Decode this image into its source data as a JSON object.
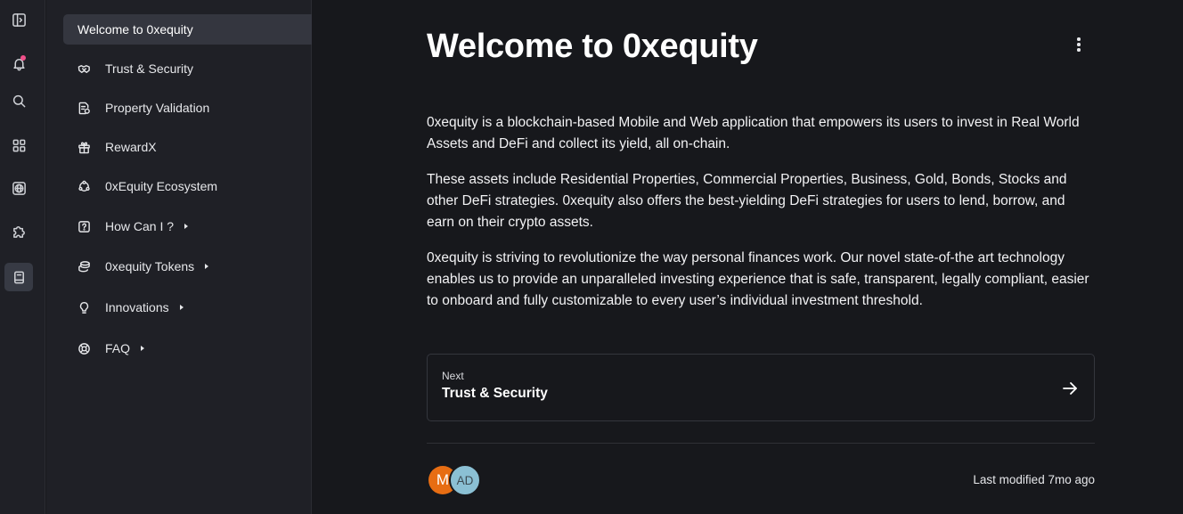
{
  "rail": {
    "icons": [
      "sidebar-toggle-icon",
      "bell-icon",
      "search-icon",
      "grid-icon",
      "globe-icon",
      "puzzle-icon",
      "book-icon"
    ]
  },
  "sidebar": {
    "items": [
      {
        "label": "Welcome to 0xequity",
        "icon": null,
        "active": true,
        "has_submenu": false
      },
      {
        "label": "Trust & Security",
        "icon": "handshake-icon",
        "has_submenu": false
      },
      {
        "label": "Property Validation",
        "icon": "document-check-icon",
        "has_submenu": false
      },
      {
        "label": "RewardX",
        "icon": "gift-icon",
        "has_submenu": false
      },
      {
        "label": "0xEquity Ecosystem",
        "icon": "circle-nodes-icon",
        "has_submenu": false
      },
      {
        "label": "How Can I ?",
        "icon": "question-square-icon",
        "has_submenu": true
      },
      {
        "label": "0xequity Tokens",
        "icon": "coins-icon",
        "has_submenu": true
      },
      {
        "label": "Innovations",
        "icon": "lightbulb-icon",
        "has_submenu": true
      },
      {
        "label": "FAQ",
        "icon": "help-circle-icon",
        "has_submenu": true
      }
    ]
  },
  "main": {
    "title": "Welcome to 0xequity",
    "paragraphs": [
      "0xequity is a blockchain-based Mobile and Web application that empowers its users to invest in Real World Assets and DeFi and collect its yield, all on-chain.",
      "These assets include Residential Properties, Commercial Properties, Business, Gold, Bonds, Stocks and other DeFi strategies. 0xequity also offers the best-yielding DeFi strategies for users to lend, borrow, and earn on their crypto assets.",
      "0xequity is striving to revolutionize the way personal finances work. Our novel state-of-the art technology enables us to provide an unparalleled investing experience that is safe, transparent, legally compliant, easier to onboard and fully customizable to every user’s individual investment threshold."
    ],
    "next": {
      "label": "Next",
      "title": "Trust & Security"
    },
    "avatars": [
      "M",
      "AD"
    ],
    "last_modified": "Last modified 7mo ago"
  },
  "colors": {
    "background": "#17181c",
    "sidebar": "#1f2026",
    "active_item": "#34363f",
    "notification_dot": "#f0508a",
    "avatar_m": "#e76d13",
    "avatar_ad": "#8bc0d4"
  }
}
